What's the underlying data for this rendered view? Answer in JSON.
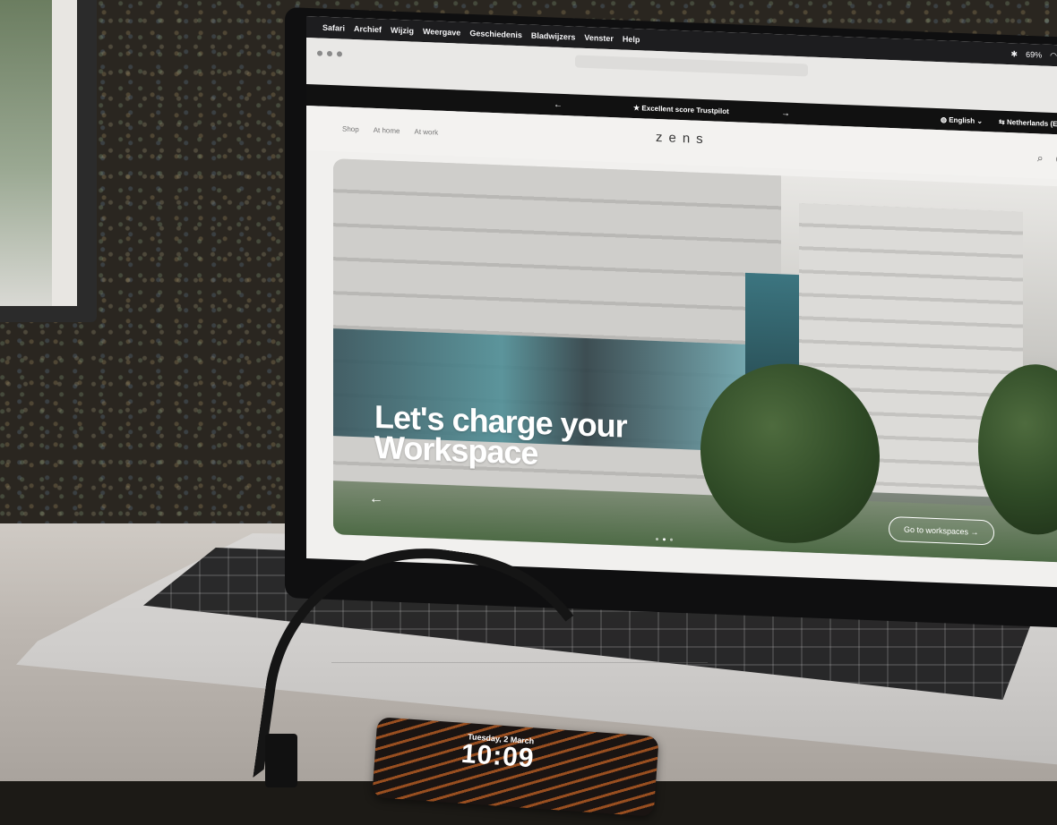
{
  "menubar": {
    "apple_icon": "apple-icon",
    "items": [
      "Safari",
      "Archief",
      "Wijzig",
      "Weergave",
      "Geschiedenis",
      "Bladwijzers",
      "Venster",
      "Help"
    ],
    "battery": "69%"
  },
  "announcement": {
    "text": "Excellent score Trustpilot",
    "language": "English",
    "region": "Netherlands (EUR"
  },
  "site": {
    "nav": [
      "Shop",
      "At home",
      "At work"
    ],
    "logo": "zens"
  },
  "hero": {
    "title_line1": "Let's charge your",
    "title_line2": "Workspace",
    "cta": "Go to workspaces"
  },
  "phone": {
    "date": "Tuesday, 2 March",
    "time": "10:09"
  },
  "colors": {
    "announce_bg": "#111111",
    "page_bg": "#f3f2f0",
    "phone_accent": "#dc6e28"
  }
}
